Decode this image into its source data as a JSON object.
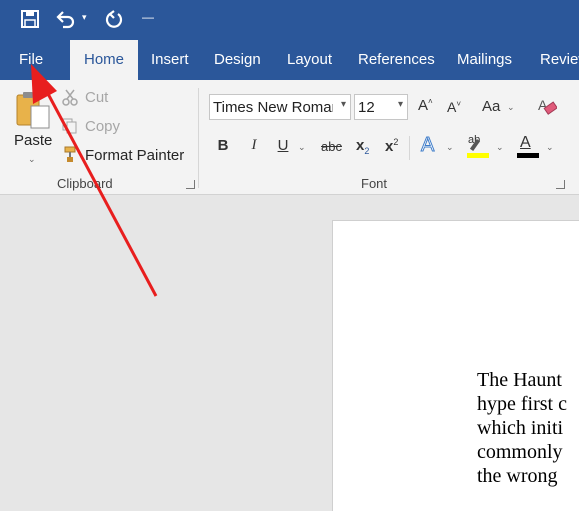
{
  "quick_access": {
    "save_icon": "save-icon",
    "undo_icon": "undo-icon",
    "redo_icon": "redo-icon",
    "customize_icon": "customize-qat-icon"
  },
  "tabs": [
    {
      "label": "File"
    },
    {
      "label": "Home"
    },
    {
      "label": "Insert"
    },
    {
      "label": "Design"
    },
    {
      "label": "Layout"
    },
    {
      "label": "References"
    },
    {
      "label": "Mailings"
    },
    {
      "label": "Review"
    }
  ],
  "clipboard": {
    "paste_label": "Paste",
    "cut_label": "Cut",
    "copy_label": "Copy",
    "format_painter_label": "Format Painter",
    "group_label": "Clipboard"
  },
  "font": {
    "font_name": "Times New Roman",
    "font_size": "12",
    "group_label": "Font",
    "bold": "B",
    "italic": "I",
    "underline": "U",
    "strikethrough": "abc",
    "subscript": "x",
    "subscript_mark": "2",
    "superscript": "x",
    "superscript_mark": "2",
    "grow": "A",
    "shrink": "A",
    "change_case": "Aa",
    "text_effects": "A",
    "highlight": "ab",
    "font_color": "A"
  },
  "document": {
    "lines": [
      "The Haunt",
      "hype first c",
      "which initi",
      "commonly",
      "the wrong"
    ]
  },
  "colors": {
    "ribbon_blue": "#2b579a",
    "highlight_yellow": "#ffff00",
    "font_color_red": "#000000",
    "annotation_red": "#e81e1e"
  }
}
